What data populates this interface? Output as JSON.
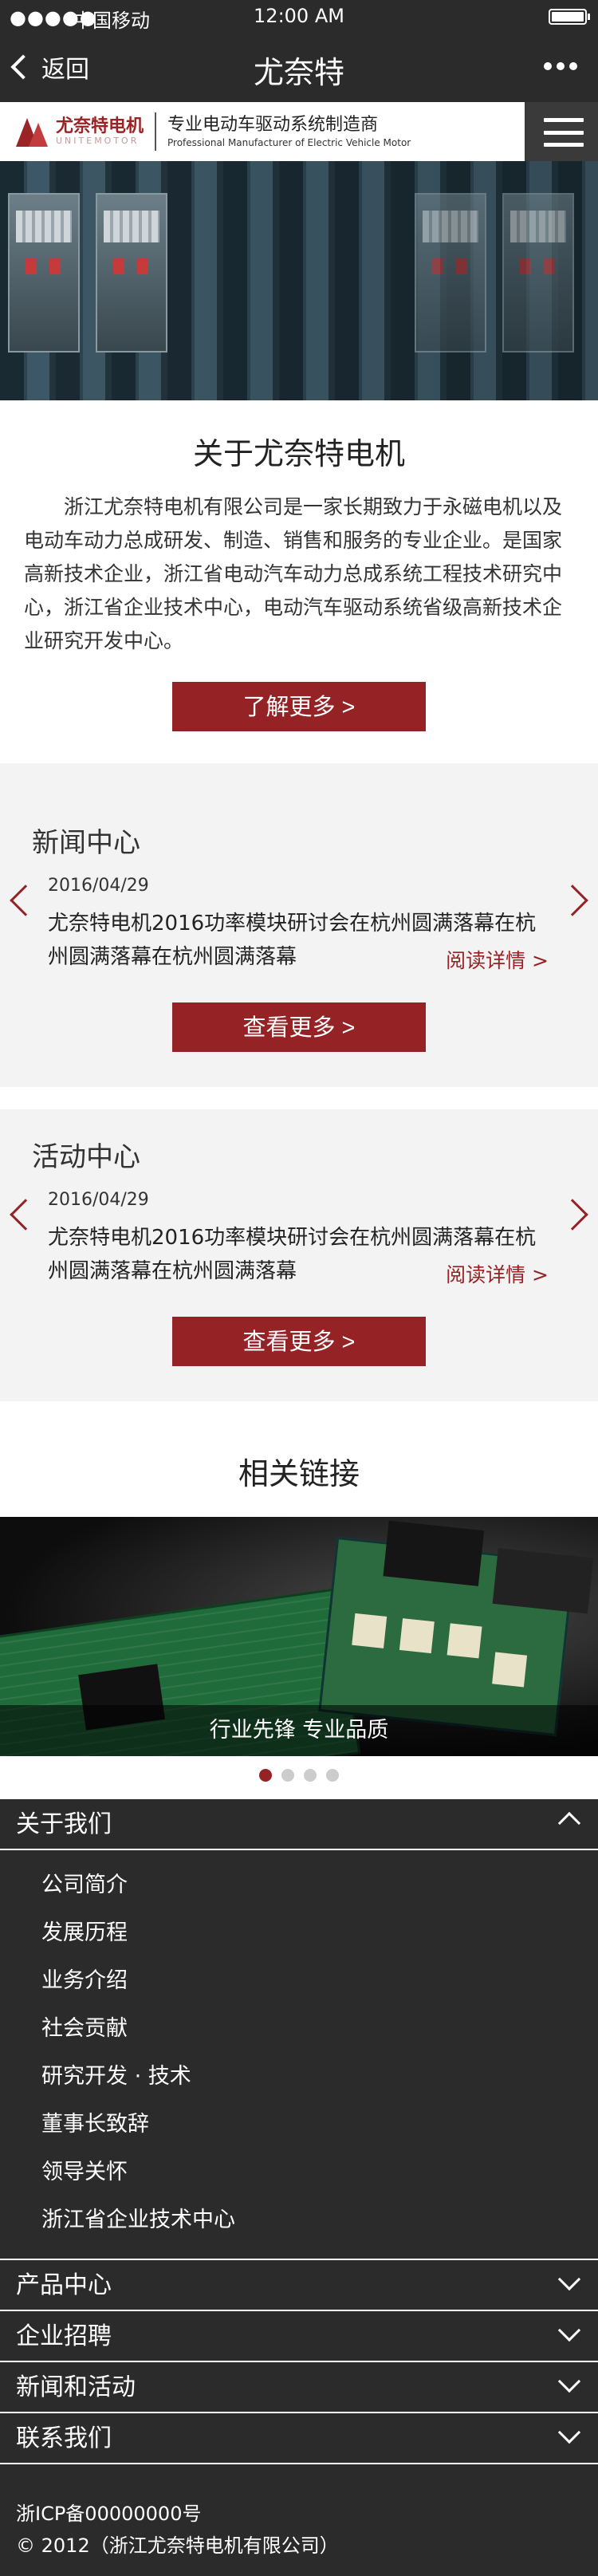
{
  "status": {
    "signal": "●●●●●",
    "carrier": "中国移动",
    "time": "12:00 AM"
  },
  "navbar": {
    "back_label": "返回",
    "title": "尤奈特",
    "more_icon": "ellipsis-icon"
  },
  "header": {
    "logo_cn": "尤奈特电机",
    "logo_en": "UNITEMOTOR",
    "slogan_cn": "专业电动车驱动系统制造商",
    "slogan_en": "Professional Manufacturer of Electric Vehicle Motor",
    "menu_icon": "hamburger-icon"
  },
  "intro": {
    "title": "关于尤奈特电机",
    "text": "浙江尤奈特电机有限公司是一家长期致力于永磁电机以及电动车动力总成研发、制造、销售和服务的专业企业。是国家高新技术企业，浙江省电动汽车动力总成系统工程技术研究中心，浙江省企业技术中心，电动汽车驱动系统省级高新技术企业研究开发中心。",
    "button": "了解更多 >"
  },
  "news": {
    "title": "新闻中心",
    "date": "2016/04/29",
    "headline": "尤奈特电机2016功率模块研讨会在杭州圆满落幕在杭州圆满落幕在杭州圆满落幕",
    "read_more": "阅读详情 >",
    "button": "查看更多 >"
  },
  "activities": {
    "title": "活动中心",
    "date": "2016/04/29",
    "headline": "尤奈特电机2016功率模块研讨会在杭州圆满落幕在杭州圆满落幕在杭州圆满落幕",
    "read_more": "阅读详情 >",
    "button": "查看更多 >"
  },
  "links": {
    "title": "相关链接",
    "caption": "行业先锋 专业品质",
    "active_slide": 1,
    "slide_count": 4
  },
  "footer_nav": {
    "about": {
      "label": "关于我们",
      "items": [
        "公司简介",
        "发展历程",
        "业务介绍",
        "社会贡献",
        "研究开发 · 技术",
        "董事长致辞",
        "领导关怀",
        "浙江省企业技术中心"
      ]
    },
    "products": "产品中心",
    "jobs": "企业招聘",
    "news": "新闻和活动",
    "contact": "联系我们"
  },
  "footer": {
    "icp": "浙ICP备00000000号",
    "copyright": "© 2012（浙江尤奈特电机有限公司）"
  },
  "colors": {
    "brand": "#952326",
    "dark": "#2b2b2b"
  }
}
